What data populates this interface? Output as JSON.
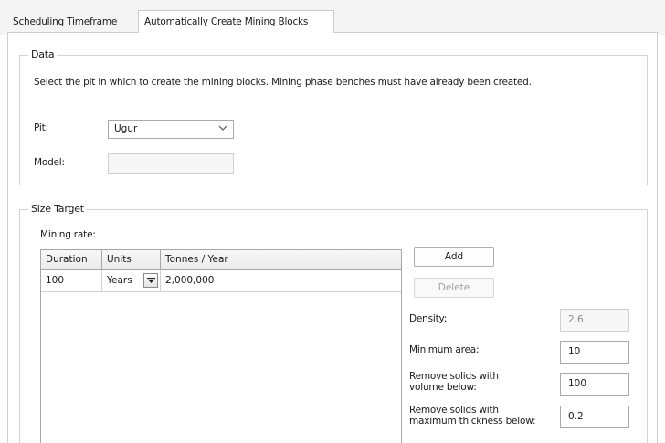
{
  "tabs": {
    "scheduling": "Scheduling Timeframe",
    "create_blocks": "Automatically Create Mining Blocks"
  },
  "data_group": {
    "title": "Data",
    "instructions": "Select the pit in which to create the mining blocks. Mining phase benches must have already been created.",
    "pit_label": "Pit:",
    "pit_value": "Ugur",
    "model_label": "Model:",
    "model_value": ""
  },
  "size_group": {
    "title": "Size Target",
    "mining_rate_label": "Mining rate:",
    "columns": [
      "Duration",
      "Units",
      "Tonnes / Year"
    ],
    "rows": [
      {
        "duration": "100",
        "units": "Years",
        "tonnes": "2,000,000"
      }
    ],
    "add_label": "Add",
    "delete_label": "Delete",
    "density_label": "Density:",
    "density_value": "2.6",
    "min_area_label": "Minimum area:",
    "min_area_value": "10",
    "remove_volume_label_line1": "Remove solids with",
    "remove_volume_label_line2": "volume below:",
    "remove_volume_value": "100",
    "remove_thickness_label_line1": "Remove solids with",
    "remove_thickness_label_line2": "maximum thickness below:",
    "remove_thickness_value": "0.2"
  }
}
